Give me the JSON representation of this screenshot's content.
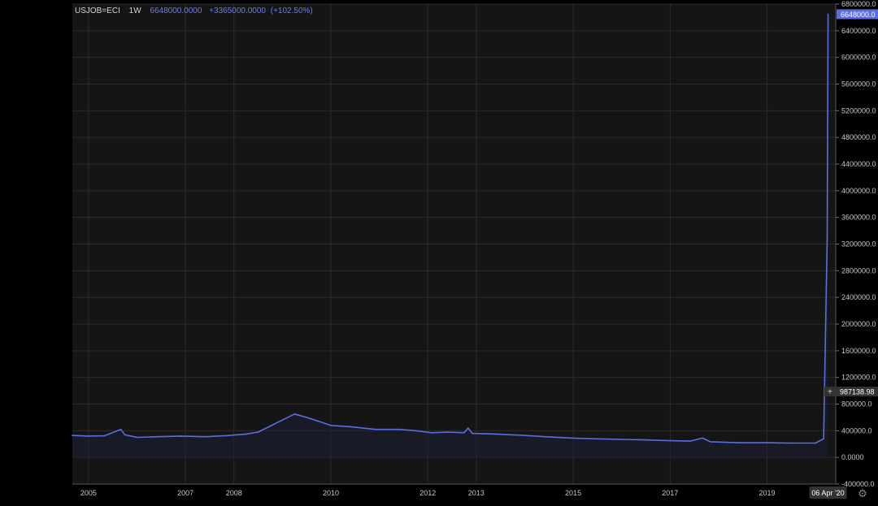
{
  "legend": {
    "symbol": "USJOB=ECI",
    "timeframe": "1W",
    "value": "6648000.0000",
    "change": "+3365000.0000",
    "change_pct": "(+102.50%)"
  },
  "price_label": "6648000.0",
  "crosshair_label": "987138.98",
  "crosshair_plus": "+",
  "time_label": "06 Apr '20",
  "settings_icon": "gear-icon",
  "colors": {
    "background": "#151515",
    "grid": "#2b2b2b",
    "line": "#5b6ee1",
    "axis_text": "#c8c8c8",
    "price_label_bg": "#5b6ee1",
    "crosshair_bg": "#333333"
  },
  "chart_data": {
    "type": "line",
    "title": "",
    "xlabel": "",
    "ylabel": "",
    "x_ticks": [
      "2005",
      "2007",
      "2008",
      "2010",
      "2012",
      "2013",
      "2015",
      "2017",
      "2019"
    ],
    "y_ticks": [
      "-400000.0",
      "0.0000",
      "400000.0",
      "800000.0",
      "1200000.0",
      "1600000.0",
      "2000000.0",
      "2400000.0",
      "2800000.0",
      "3200000.0",
      "3600000.0",
      "4000000.0",
      "4400000.0",
      "4800000.0",
      "5200000.0",
      "5600000.0",
      "6000000.0",
      "6400000.0",
      "6800000.0"
    ],
    "ylim": [
      -400000,
      6800000
    ],
    "xlim": [
      "2004-09",
      "2020-06"
    ],
    "grid": true,
    "legend_position": "top-left",
    "series": [
      {
        "name": "USJOB=ECI",
        "points": [
          [
            "2004-09",
            330000
          ],
          [
            "2005-01",
            320000
          ],
          [
            "2005-05",
            325000
          ],
          [
            "2005-09",
            420000
          ],
          [
            "2005-10",
            340000
          ],
          [
            "2006-01",
            300000
          ],
          [
            "2006-06",
            310000
          ],
          [
            "2006-12",
            320000
          ],
          [
            "2007-06",
            310000
          ],
          [
            "2007-12",
            330000
          ],
          [
            "2008-04",
            350000
          ],
          [
            "2008-07",
            380000
          ],
          [
            "2008-10",
            470000
          ],
          [
            "2009-01",
            560000
          ],
          [
            "2009-04",
            650000
          ],
          [
            "2009-07",
            600000
          ],
          [
            "2009-10",
            540000
          ],
          [
            "2010-01",
            480000
          ],
          [
            "2010-06",
            460000
          ],
          [
            "2010-12",
            420000
          ],
          [
            "2011-06",
            420000
          ],
          [
            "2011-10",
            400000
          ],
          [
            "2012-02",
            370000
          ],
          [
            "2012-06",
            380000
          ],
          [
            "2012-10",
            370000
          ],
          [
            "2012-11",
            440000
          ],
          [
            "2012-12",
            360000
          ],
          [
            "2013-06",
            350000
          ],
          [
            "2014-01",
            330000
          ],
          [
            "2014-06",
            310000
          ],
          [
            "2015-01",
            290000
          ],
          [
            "2015-06",
            280000
          ],
          [
            "2016-01",
            270000
          ],
          [
            "2016-06",
            265000
          ],
          [
            "2017-01",
            250000
          ],
          [
            "2017-06",
            245000
          ],
          [
            "2017-09",
            290000
          ],
          [
            "2017-11",
            235000
          ],
          [
            "2018-06",
            220000
          ],
          [
            "2019-01",
            220000
          ],
          [
            "2019-06",
            215000
          ],
          [
            "2020-01",
            215000
          ],
          [
            "2020-03",
            280000
          ],
          [
            "2020-03-28",
            3283000
          ],
          [
            "2020-04-04",
            6648000
          ]
        ]
      }
    ]
  }
}
